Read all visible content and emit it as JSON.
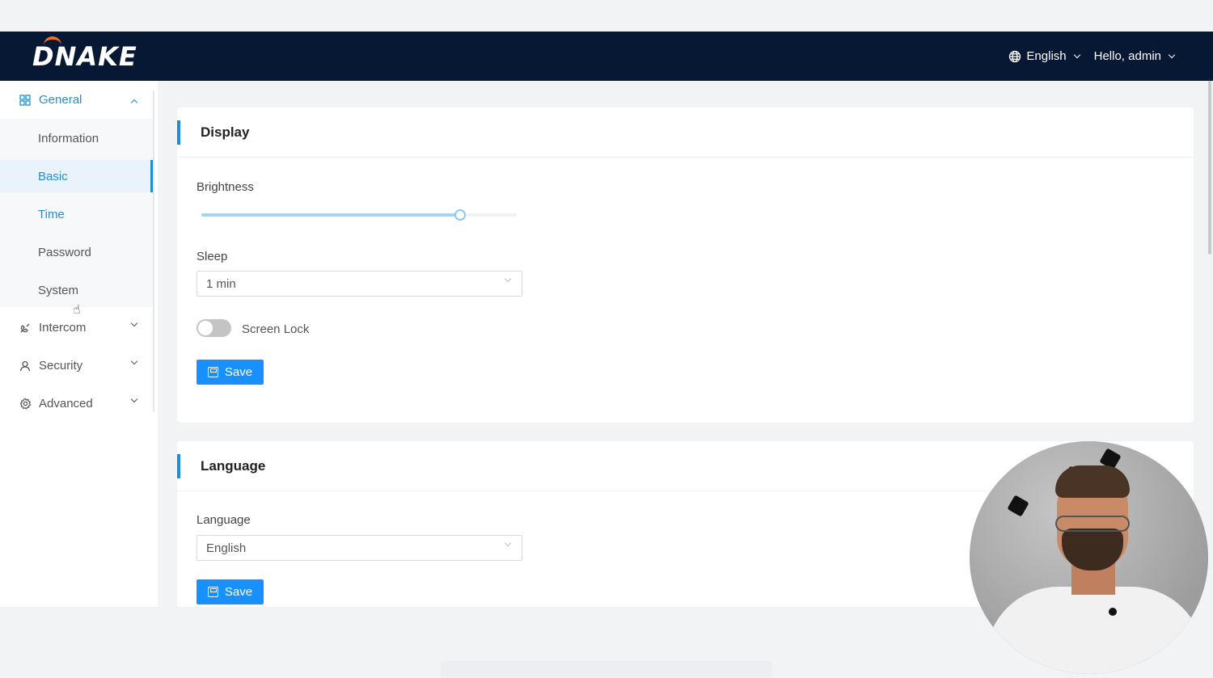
{
  "header": {
    "logo": "DNAKE",
    "language": "English",
    "user": "Hello, admin"
  },
  "sidebar": {
    "groups": [
      {
        "label": "General",
        "icon": "grid-icon",
        "expanded": true
      },
      {
        "label": "Intercom",
        "icon": "phone-icon",
        "expanded": false
      },
      {
        "label": "Security",
        "icon": "user-icon",
        "expanded": false
      },
      {
        "label": "Advanced",
        "icon": "gear-icon",
        "expanded": false
      }
    ],
    "general_items": [
      "Information",
      "Basic",
      "Time",
      "Password",
      "System"
    ],
    "active_item": "Basic"
  },
  "display": {
    "title": "Display",
    "brightness_label": "Brightness",
    "brightness_fraction": 0.82,
    "sleep_label": "Sleep",
    "sleep_value": "1 min",
    "screen_lock_label": "Screen Lock",
    "screen_lock_on": false,
    "save_label": "Save"
  },
  "language": {
    "title": "Language",
    "language_label": "Language",
    "language_value": "English",
    "save_label": "Save"
  },
  "colors": {
    "header_bg": "#071834",
    "accent": "#1e8fd6",
    "button": "#1890ff"
  }
}
